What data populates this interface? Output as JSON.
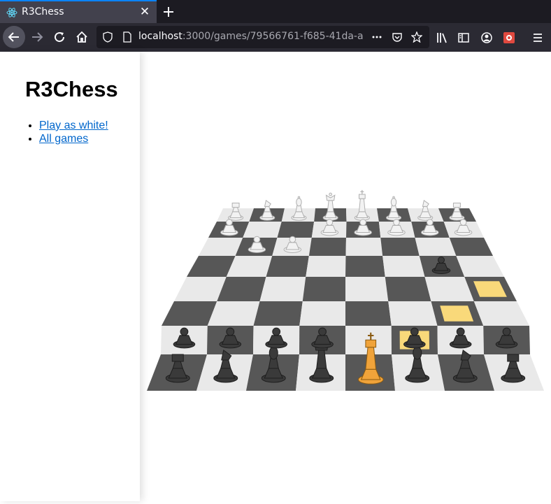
{
  "browser": {
    "tab_title": "R3Chess",
    "url_host": "localhost",
    "url_rest": ":3000/games/79566761-f685-41da-a"
  },
  "sidebar": {
    "title": "R3Chess",
    "links": [
      "Play as white!",
      "All games"
    ]
  },
  "board": {
    "light_square": "#e9e9e9",
    "dark_square": "#575757",
    "highlight": "#f9d97a",
    "white_pieces": [
      "rook",
      "knight",
      "bishop",
      "queen",
      "king",
      "bishop",
      "knight",
      "rook",
      "pawn",
      "pawn",
      "pawn",
      "pawn",
      "pawn",
      "pawn",
      "pawn",
      "pawn"
    ],
    "black_pieces": [
      "rook",
      "knight",
      "bishop",
      "queen",
      "king",
      "bishop",
      "knight",
      "rook",
      "pawn",
      "pawn",
      "pawn",
      "pawn",
      "pawn",
      "pawn",
      "pawn"
    ],
    "selected_piece": "king"
  },
  "colors": {
    "selected": "#f0a33a",
    "link": "#0066cc"
  }
}
